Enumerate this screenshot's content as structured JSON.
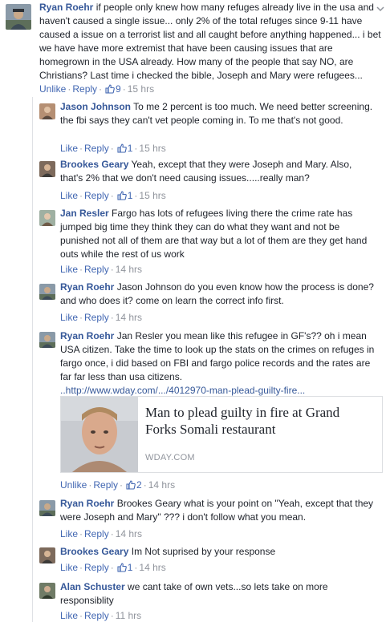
{
  "comments": [
    {
      "author": "Ryan Roehr",
      "text": "if people only knew how many refuges already live in the usa and haven't caused a single issue... only 2% of the total refuges since 9-11 have caused a issue on a terrorist list and all caught before anything happened... i bet we have have more extremist that have been causing issues that are homegrown in the USA already. How many of the people that say NO, are Christians? Last time i checked the bible, Joseph and Mary were refugees...",
      "like_label": "Unlike",
      "reply_label": "Reply",
      "likes": "9",
      "time": "15 hrs"
    }
  ],
  "replies": [
    {
      "author": "Jason Johnson",
      "text": "To me 2 percent is too much. We need better screening. the fbi says they can't vet people coming in. To me that's not good.",
      "like_label": "Like",
      "reply_label": "Reply",
      "likes": "1",
      "time": "15 hrs"
    },
    {
      "author": "Brookes Geary",
      "text": "Yeah, except that they were Joseph and Mary. Also, that's 2% that we don't need causing issues.....really man?",
      "like_label": "Like",
      "reply_label": "Reply",
      "likes": "1",
      "time": "15 hrs"
    },
    {
      "author": "Jan Resler",
      "text": "Fargo has lots of refugees living there the crime rate has jumped big time they think they can do what they want and not be punished not all of them are that way but a lot of them are they get hand outs while the rest of us work",
      "like_label": "Like",
      "reply_label": "Reply",
      "time": "14 hrs"
    },
    {
      "author": "Ryan Roehr",
      "text": "Jason Johnson do you even know how the process is done? and who does it? come on learn the correct info first.",
      "like_label": "Like",
      "reply_label": "Reply",
      "time": "14 hrs"
    },
    {
      "author": "Ryan Roehr",
      "text": "Jan Resler you mean like this refugee in GF's?? oh i mean USA citizen. Take the time to look up the stats on the crimes on refuges in fargo once, i did based on FBI and fargo police records and the rates are far far less than usa citizens.",
      "link": "..http://www.wday.com/.../4012970-man-plead-guilty-fire...",
      "preview_title": "Man to plead guilty in fire at Grand Forks Somali restaurant",
      "preview_source": "WDAY.COM",
      "like_label": "Unlike",
      "reply_label": "Reply",
      "likes": "2",
      "time": "14 hrs"
    },
    {
      "author": "Ryan Roehr",
      "text": "Brookes Geary what is your point on \"Yeah, except that they were Joseph and Mary\" ??? i don't follow what you mean.",
      "like_label": "Like",
      "reply_label": "Reply",
      "time": "14 hrs"
    },
    {
      "author": "Brookes Geary",
      "text": "Im Not suprised by your response",
      "like_label": "Like",
      "reply_label": "Reply",
      "likes": "1",
      "time": "14 hrs"
    },
    {
      "author": "Alan Schuster",
      "text": "we cant take of own vets...so lets take on more responsiblity",
      "like_label": "Like",
      "reply_label": "Reply",
      "time": "11 hrs"
    }
  ],
  "colors": {
    "author_link": "#365899",
    "action_link": "#4267b2",
    "meta_gray": "#90949c",
    "text": "#1d2129"
  },
  "icons": [
    "thumbs-up-icon",
    "chevron-down-icon"
  ]
}
